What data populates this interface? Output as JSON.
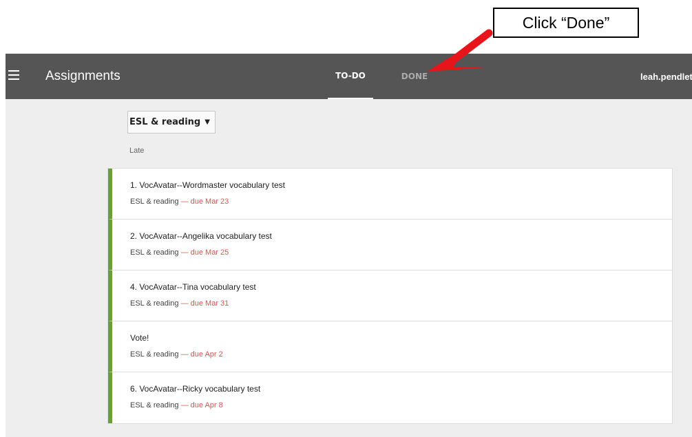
{
  "annotation": {
    "callout_text": "Click “Done”"
  },
  "appbar": {
    "title": "Assignments",
    "tabs": {
      "todo": "TO-DO",
      "done": "DONE"
    },
    "user": "leah.pendleton"
  },
  "filter": {
    "class_label": "ESL & reading"
  },
  "section": {
    "label": "Late"
  },
  "assignments": [
    {
      "title": "1. VocAvatar--Wordmaster vocabulary test",
      "class": "ESL & reading",
      "due": "— due Mar 23"
    },
    {
      "title": "2. VocAvatar--Angelika vocabulary test",
      "class": "ESL & reading",
      "due": "— due Mar 25"
    },
    {
      "title": "4. VocAvatar--Tina vocabulary test",
      "class": "ESL & reading",
      "due": "— due Mar 31"
    },
    {
      "title": "Vote!",
      "class": "ESL & reading",
      "due": "— due Apr 2"
    },
    {
      "title": "6. VocAvatar--Ricky vocabulary test",
      "class": "ESL & reading",
      "due": "— due Apr 8"
    }
  ],
  "colors": {
    "appbar": "#555555",
    "accent_bar": "#6a9e3a",
    "due_text": "#d9534f",
    "arrow": "#e8141c"
  }
}
